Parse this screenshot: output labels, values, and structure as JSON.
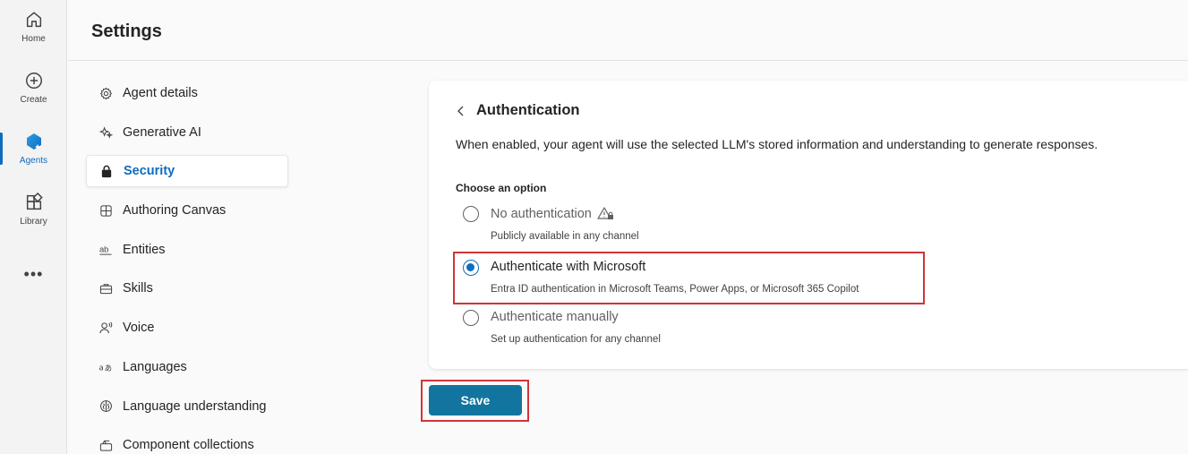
{
  "rail": {
    "items": [
      {
        "label": "Home",
        "icon": "home-icon"
      },
      {
        "label": "Create",
        "icon": "plus-circle-icon"
      },
      {
        "label": "Agents",
        "icon": "agents-icon"
      },
      {
        "label": "Library",
        "icon": "library-icon"
      }
    ],
    "more": "•••"
  },
  "header": {
    "title": "Settings"
  },
  "nav": {
    "items": [
      {
        "label": "Agent details",
        "icon": "gear-icon"
      },
      {
        "label": "Generative AI",
        "icon": "sparkle-icon"
      },
      {
        "label": "Security",
        "icon": "lock-icon"
      },
      {
        "label": "Authoring Canvas",
        "icon": "grid-icon"
      },
      {
        "label": "Entities",
        "icon": "text-ab-icon"
      },
      {
        "label": "Skills",
        "icon": "briefcase-icon"
      },
      {
        "label": "Voice",
        "icon": "person-voice-icon"
      },
      {
        "label": "Languages",
        "icon": "translate-icon"
      },
      {
        "label": "Language understanding",
        "icon": "brain-icon"
      },
      {
        "label": "Component collections",
        "icon": "collection-icon"
      }
    ],
    "active_index": 2
  },
  "auth": {
    "title": "Authentication",
    "description": "When enabled, your agent will use the selected LLM's stored information and understanding to generate responses.",
    "group_label": "Choose an option",
    "options": [
      {
        "label": "No authentication",
        "description": "Publicly available in any channel",
        "selected": false
      },
      {
        "label": "Authenticate with Microsoft",
        "description": "Entra ID authentication in Microsoft Teams, Power Apps, or Microsoft 365 Copilot",
        "selected": true
      },
      {
        "label": "Authenticate manually",
        "description": "Set up authentication for any channel",
        "selected": false
      }
    ]
  },
  "save_label": "Save",
  "colors": {
    "accent": "#0f6cbd",
    "save_button": "#11759f",
    "highlight": "#d13438"
  }
}
